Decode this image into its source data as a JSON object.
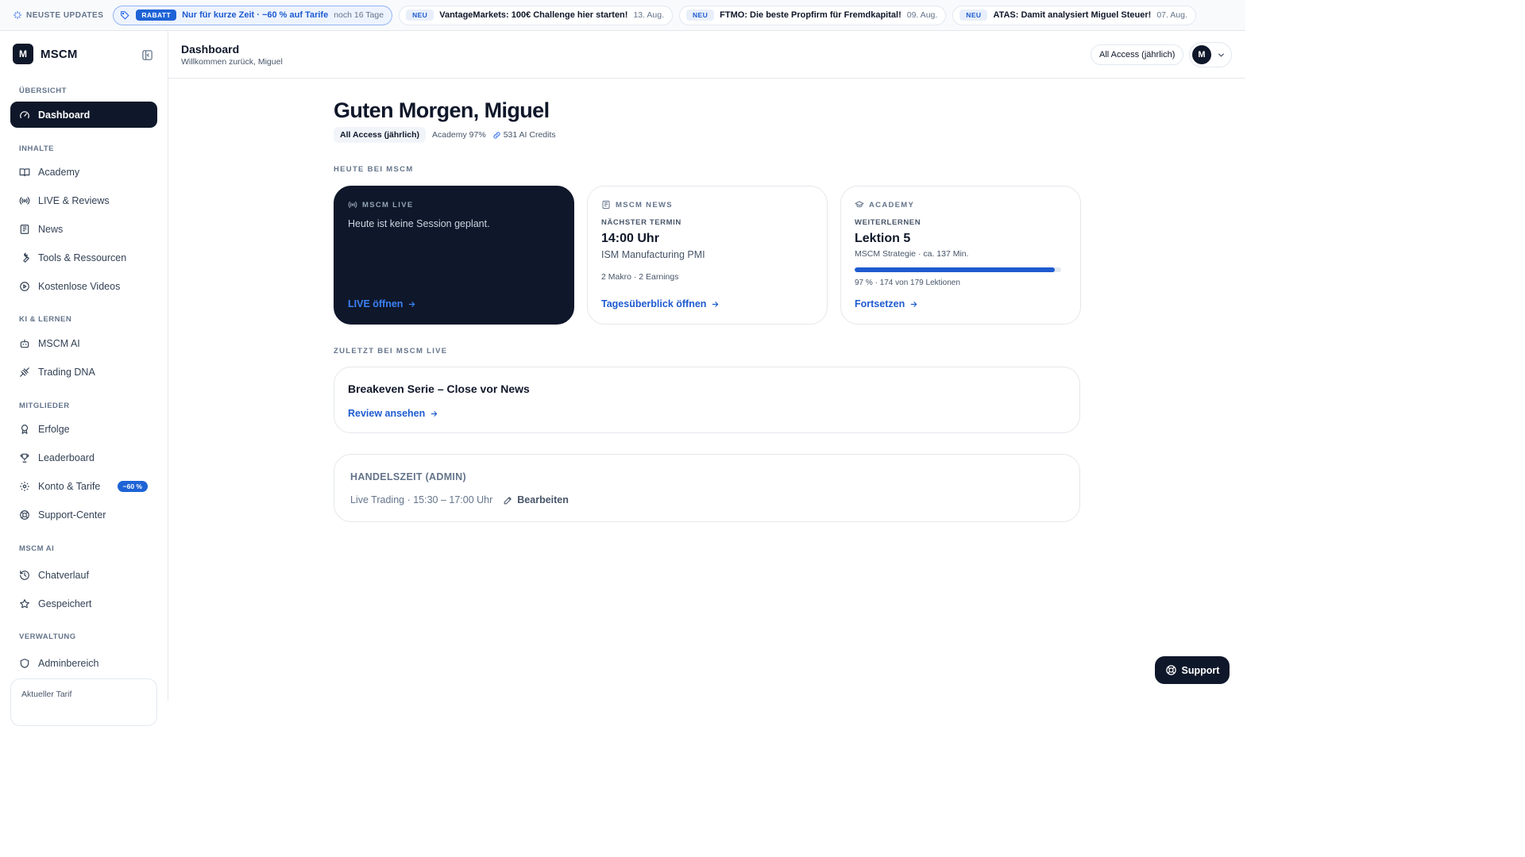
{
  "updates": {
    "label": "NEUSTE UPDATES",
    "promo": {
      "badge": "RABATT",
      "text": "Nur für kurze Zeit · −60 % auf Tarife",
      "time_left": "noch 16 Tage"
    },
    "items": [
      {
        "badge": "NEU",
        "title": "VantageMarkets: 100€ Challenge hier starten!",
        "date": "13. Aug."
      },
      {
        "badge": "NEU",
        "title": "FTMO: Die beste Propfirm für Fremdkapital!",
        "date": "09. Aug."
      },
      {
        "badge": "NEU",
        "title": "ATAS: Damit analysiert Miguel Steuer!",
        "date": "07. Aug."
      }
    ]
  },
  "sidebar": {
    "brand": {
      "logo": "M",
      "name": "MSCM"
    },
    "sections": [
      {
        "label": "ÜBERSICHT",
        "items": [
          {
            "label": "Dashboard",
            "icon": "gauge-icon",
            "active": true
          }
        ]
      },
      {
        "label": "INHALTE",
        "items": [
          {
            "label": "Academy",
            "icon": "book-icon"
          },
          {
            "label": "LIVE & Reviews",
            "icon": "broadcast-icon"
          },
          {
            "label": "News",
            "icon": "newspaper-icon"
          },
          {
            "label": "Tools & Ressourcen",
            "icon": "wrench-icon"
          },
          {
            "label": "Kostenlose Videos",
            "icon": "play-circle-icon"
          }
        ]
      },
      {
        "label": "KI & LERNEN",
        "items": [
          {
            "label": "MSCM AI",
            "icon": "bot-icon"
          },
          {
            "label": "Trading DNA",
            "icon": "dna-icon"
          }
        ]
      },
      {
        "label": "MITGLIEDER",
        "items": [
          {
            "label": "Erfolge",
            "icon": "award-icon"
          },
          {
            "label": "Leaderboard",
            "icon": "trophy-icon"
          },
          {
            "label": "Konto & Tarife",
            "icon": "gear-icon",
            "badge": "−60 %"
          },
          {
            "label": "Support-Center",
            "icon": "lifebuoy-icon"
          }
        ]
      },
      {
        "label": "MSCM AI",
        "items": [
          {
            "label": "Chatverlauf",
            "icon": "history-icon"
          },
          {
            "label": "Gespeichert",
            "icon": "star-icon"
          }
        ]
      },
      {
        "label": "VERWALTUNG",
        "items": [
          {
            "label": "Adminbereich",
            "icon": "shield-icon"
          }
        ]
      }
    ],
    "tarif_label": "Aktueller Tarif"
  },
  "header": {
    "title": "Dashboard",
    "subtitle": "Willkommen zurück, Miguel",
    "plan": "All Access (jährlich)",
    "avatar": "M"
  },
  "main": {
    "greeting": "Guten Morgen, Miguel",
    "chips": {
      "plan": "All Access (jährlich)",
      "academy": "Academy 97%",
      "credits": "531 AI Credits"
    },
    "today_label": "HEUTE BEI MSCM",
    "cards": {
      "live": {
        "title": "MSCM LIVE",
        "text": "Heute ist keine Session geplant.",
        "link": "LIVE öffnen"
      },
      "news": {
        "title": "MSCM NEWS",
        "subtitle": "NÄCHSTER TERMIN",
        "time": "14:00 Uhr",
        "event": "ISM Manufacturing PMI",
        "meta": "2 Makro · 2 Earnings",
        "link": "Tagesüberblick öffnen"
      },
      "academy": {
        "title": "ACADEMY",
        "subtitle": "WEITERLERNEN",
        "lesson": "Lektion 5",
        "meta": "MSCM Strategie · ca. 137 Min.",
        "progress": 0.97,
        "progress_text": "97 % · 174 von 179 Lektionen",
        "link": "Fortsetzen"
      }
    },
    "recent_label": "ZULETZT BEI MSCM LIVE",
    "recent": {
      "title": "Breakeven Serie – Close vor News",
      "link": "Review ansehen"
    },
    "admin": {
      "title": "HANDELSZEIT (ADMIN)",
      "text": "Live Trading · 15:30 – 17:00 Uhr",
      "edit": "Bearbeiten"
    }
  },
  "support_button": "Support",
  "colors": {
    "primary_dark": "#0f172a",
    "accent_blue": "#1e5bd0",
    "border": "#e5e7eb"
  }
}
